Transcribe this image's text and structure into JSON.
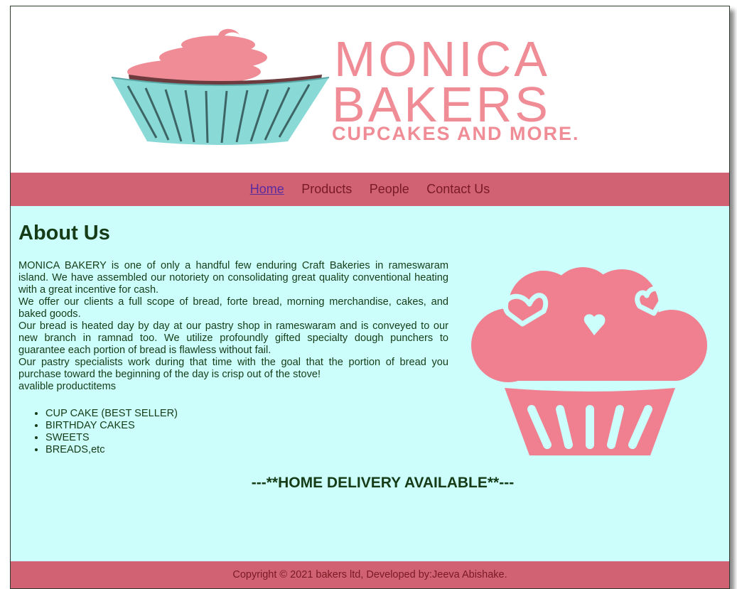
{
  "header": {
    "logo": {
      "line1": "MONICA",
      "line2": "BAKERS",
      "tagline": "CUPCAKES AND MORE."
    }
  },
  "nav": {
    "items": [
      {
        "label": "Home"
      },
      {
        "label": "Products"
      },
      {
        "label": "People"
      },
      {
        "label": "Contact Us"
      }
    ]
  },
  "main": {
    "title": "About Us",
    "paragraphs": [
      "MONICA BAKERY is one of only a handful few enduring Craft Bakeries in rameswaram island. We have assembled our notoriety on consolidating great quality conventional heating with a great incentive for cash.",
      "We offer our clients a full scope of bread, forte bread, morning merchandise, cakes, and baked goods.",
      "Our bread is heated day by day at our pastry shop in rameswaram and is conveyed to our new branch in ramnad too. We utilize profoundly gifted specialty dough punchers to guarantee each portion of bread is flawless without fail.",
      "Our pastry specialists work during that time with the goal that the portion of bread you purchase toward the beginning of the day is crisp out of the stove!"
    ],
    "products_intro": "avalible productitems",
    "products": [
      "CUP CAKE (BEST SELLER)",
      "BIRTHDAY CAKES",
      "SWEETS",
      "BREADS,etc"
    ],
    "delivery": "---**HOME DELIVERY AVAILABLE**---",
    "icon": "cupcake-hearts-icon"
  },
  "footer": {
    "copyright": "Copyright © 2021 bakers ltd, Developed by:Jeeva Abishake."
  },
  "colors": {
    "nav_bg": "#d06274",
    "main_bg": "#ccfefc",
    "text": "#153b17",
    "link": "#7a1a22",
    "logo_pink": "#f08c96",
    "cup_teal": "#89d9d6"
  }
}
